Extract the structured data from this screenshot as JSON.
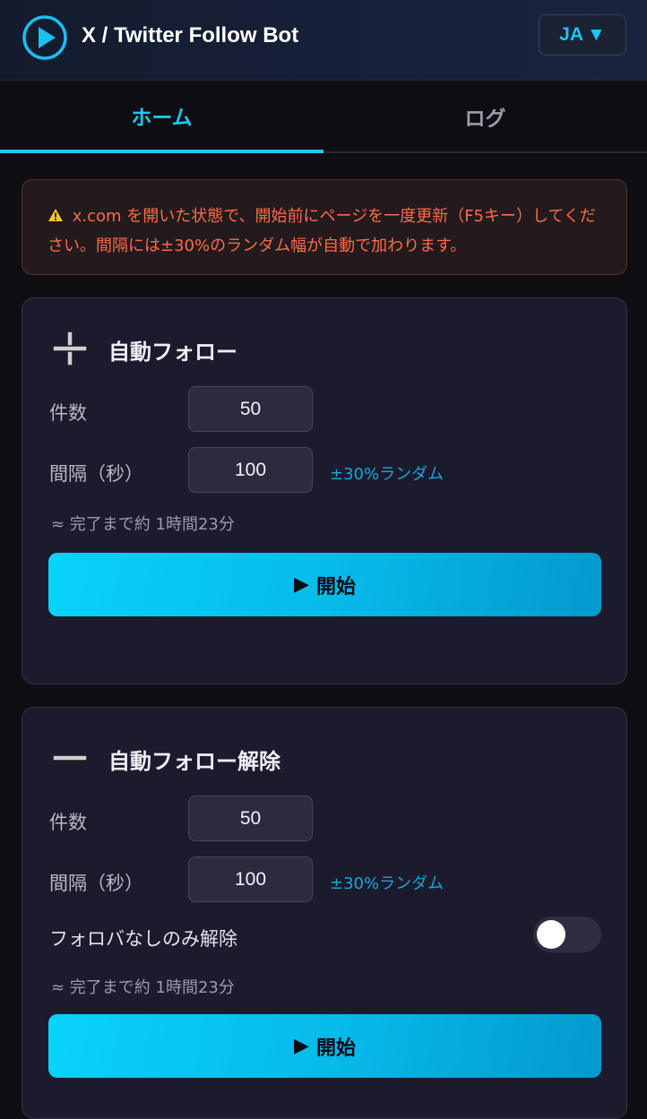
{
  "header": {
    "title": "X / Twitter Follow Bot",
    "language": "JA",
    "language_caret": "▼",
    "logo_icon": "play-circle-icon",
    "accent": "#1ec8f0"
  },
  "tabs": [
    {
      "label": "ホーム",
      "active": true
    },
    {
      "label": "ログ",
      "active": false
    }
  ],
  "notice": {
    "icon": "warning-icon",
    "text": "x.com を開いた状態で、開始前にページを一度更新（F5キー）してください。間隔には±30%のランダム幅が自動で加わります。"
  },
  "follow": {
    "title": "自動フォロー",
    "icon": "plus-icon",
    "count_label": "件数",
    "count_value": "50",
    "interval_label": "間隔（秒）",
    "interval_value": "100",
    "random_note": "±30%ランダム",
    "estimate": "≈ 完了まで約 1時間23分",
    "start_label": "開始",
    "start_icon": "▶"
  },
  "unfollow": {
    "title": "自動フォロー解除",
    "icon": "minus-icon",
    "count_label": "件数",
    "count_value": "50",
    "interval_label": "間隔（秒）",
    "interval_value": "100",
    "random_note": "±30%ランダム",
    "toggle_label": "フォロバなしのみ解除",
    "toggle_on": false,
    "estimate": "≈ 完了まで約 1時間23分",
    "start_label": "開始",
    "start_icon": "▶"
  }
}
